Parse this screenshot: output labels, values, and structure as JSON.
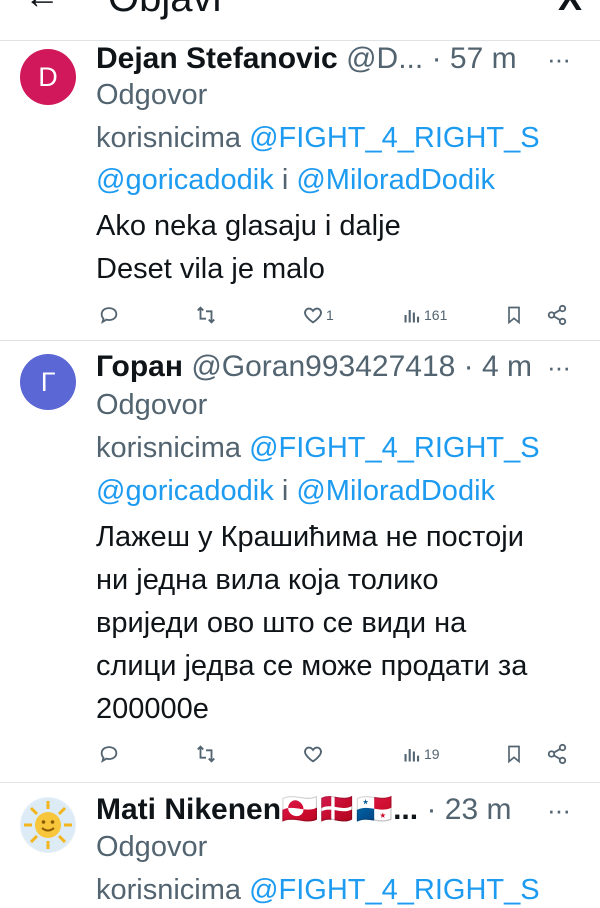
{
  "header": {
    "back_icon": "←",
    "title": "Objavi",
    "logo": "X"
  },
  "tweets": [
    {
      "avatar_letter": "D",
      "avatar_color": "#d1185a",
      "name": "Dejan Stefanovic",
      "handle": "@D...",
      "time": "· 57 m",
      "more": "···",
      "reply_prefix": "Odgovor",
      "reply_to_text": "korisnicima",
      "mention1": "@FIGHT_4_RIGHT_S",
      "mention2": "@goricadodik",
      "and": "i",
      "mention3": "@MiloradDodik",
      "lines": [
        "Ako neka glasaju i dalje",
        "Deset vila je malo"
      ],
      "likes": "1",
      "views": "161"
    },
    {
      "avatar_letter": "Г",
      "avatar_color": "#5c67d6",
      "name": "Горан",
      "handle": "@Goran993427418",
      "time": "· 4 m",
      "more": "···",
      "reply_prefix": "Odgovor",
      "reply_to_text": "korisnicima",
      "mention1": "@FIGHT_4_RIGHT_S",
      "mention2": "@goricadodik",
      "and": "i",
      "mention3": "@MiloradDodik",
      "lines": [
        "Лажеш у Крашићима не постоји",
        "ни једна вила која толико",
        "вриједи ово што се види на",
        "слици једва се може продати за",
        "200000е"
      ],
      "likes": "",
      "views": "19"
    },
    {
      "avatar_icon": "sun-face-icon",
      "name": "Mati Nikenen🇬🇱🇩🇰🇵🇦...",
      "time": "· 23 m",
      "more": "···",
      "reply_prefix": "Odgovor",
      "reply_to_text": "korisnicima",
      "mention1": "@FIGHT_4_RIGHT_S"
    }
  ],
  "colors": {
    "link": "#1d9bf0",
    "muted": "#536471",
    "text": "#0f1419",
    "divider": "#dfe3e6"
  }
}
